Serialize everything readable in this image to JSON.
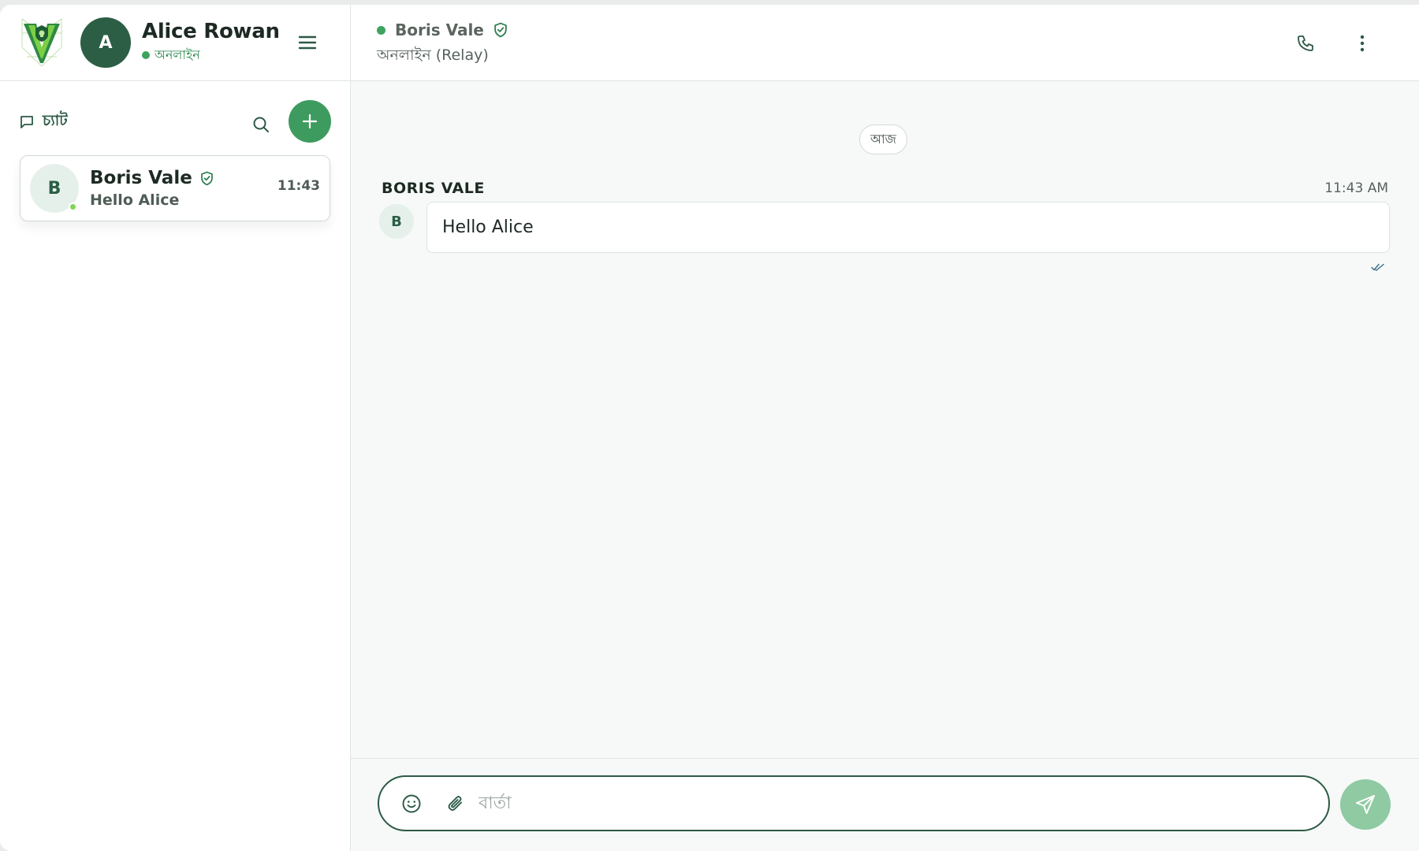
{
  "user": {
    "initial": "A",
    "name": "Alice Rowan",
    "status": "অনলাইন"
  },
  "sidebar": {
    "title": "চ্যাট",
    "chats": [
      {
        "initial": "B",
        "name": "Boris Vale",
        "preview": "Hello Alice",
        "time": "11:43",
        "verified": true,
        "online": true
      }
    ]
  },
  "conversation": {
    "peer_name": "Boris Vale",
    "peer_status": "অনলাইন (Relay)",
    "date_chip": "আজ",
    "messages": [
      {
        "sender": "BORIS VALE",
        "initial": "B",
        "time": "11:43 AM",
        "text": "Hello Alice",
        "read": true
      }
    ]
  },
  "composer": {
    "placeholder": "বার্তা"
  },
  "icons": {
    "logo": "shield-v-logo",
    "menu": "hamburger-icon",
    "chat": "chat-bubble-icon",
    "search": "search-icon",
    "add": "plus-icon",
    "verified": "shield-check-icon",
    "call": "phone-icon",
    "more": "kebab-icon",
    "emoji": "smiley-icon",
    "attach": "paperclip-icon",
    "send": "send-icon",
    "read": "double-check-icon"
  },
  "colors": {
    "accent": "#3e9b5f",
    "dark_green": "#2c5e45",
    "online": "#3da35d",
    "send_disabled": "#8fcaa2"
  }
}
